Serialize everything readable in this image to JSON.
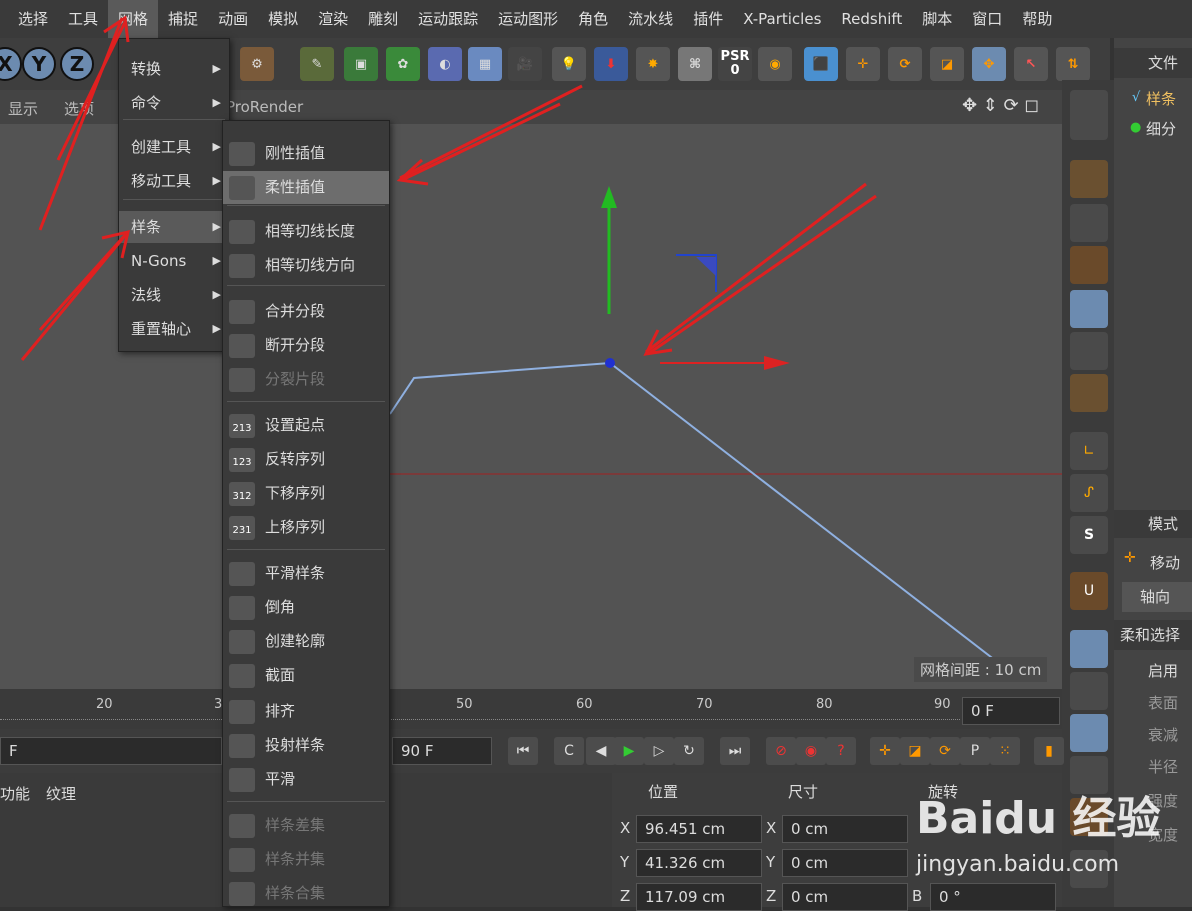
{
  "menubar": [
    "选择",
    "工具",
    "网格",
    "捕捉",
    "动画",
    "模拟",
    "渲染",
    "雕刻",
    "运动跟踪",
    "运动图形",
    "角色",
    "流水线",
    "插件",
    "X-Particles",
    "Redshift",
    "脚本",
    "窗口",
    "帮助"
  ],
  "toolbar": {
    "axis_y": "Y",
    "axis_z": "Z",
    "psr_label": "PSR",
    "psr_value": "0"
  },
  "viewport": {
    "menu_display": "显示",
    "menu_options": "选项",
    "renderer": "ProRender",
    "grid_spacing": "网格间距 : 10 cm"
  },
  "mesh_menu": {
    "items": [
      "转换",
      "命令",
      "创建工具",
      "移动工具",
      "样条",
      "N-Gons",
      "法线",
      "重置轴心"
    ]
  },
  "spline_menu": {
    "items": [
      "刚性插值",
      "柔性插值",
      "相等切线长度",
      "相等切线方向",
      "合并分段",
      "断开分段",
      "分裂片段",
      "设置起点",
      "反转序列",
      "下移序列",
      "上移序列",
      "平滑样条",
      "倒角",
      "创建轮廓",
      "截面",
      "排齐",
      "投射样条",
      "平滑",
      "样条差集",
      "样条并集",
      "样条合集"
    ],
    "icon_numbers": [
      "213",
      "123",
      "312",
      "231"
    ]
  },
  "timeline": {
    "ticks": [
      "20",
      "3",
      "50",
      "60",
      "70",
      "80",
      "90"
    ],
    "current_frame": "0 F",
    "end_frame": "90 F",
    "left_field": "F"
  },
  "lower_tabs": {
    "tab1": "功能",
    "tab2": "纹理"
  },
  "coords": {
    "header_position": "位置",
    "header_size": "尺寸",
    "header_rotation": "旋转",
    "x_label": "X",
    "y_label": "Y",
    "z_label": "Z",
    "b_label": "B",
    "pos_x": "96.451 cm",
    "pos_y": "41.326 cm",
    "pos_z": "117.09 cm",
    "size_x": "0 cm",
    "size_y": "0 cm",
    "size_z": "0 cm",
    "rot_b": "0 °"
  },
  "object_panel": {
    "title": "文件",
    "item1": "样条",
    "item2": "细分"
  },
  "attr_panel": {
    "title": "模式",
    "move": "移动",
    "axis_btn": "轴向",
    "soft_select": "柔和选择",
    "enable": "启用",
    "surface": "表面",
    "falloff": "衰减",
    "radius": "半径",
    "strength": "强度",
    "width": "宽度"
  },
  "watermark": {
    "brand": "Baidu 经验",
    "url": "jingyan.baidu.com"
  },
  "colors": {
    "accent_red": "#e02020",
    "spline_blue": "#8fb0e0",
    "axis_green": "#22bb22"
  }
}
